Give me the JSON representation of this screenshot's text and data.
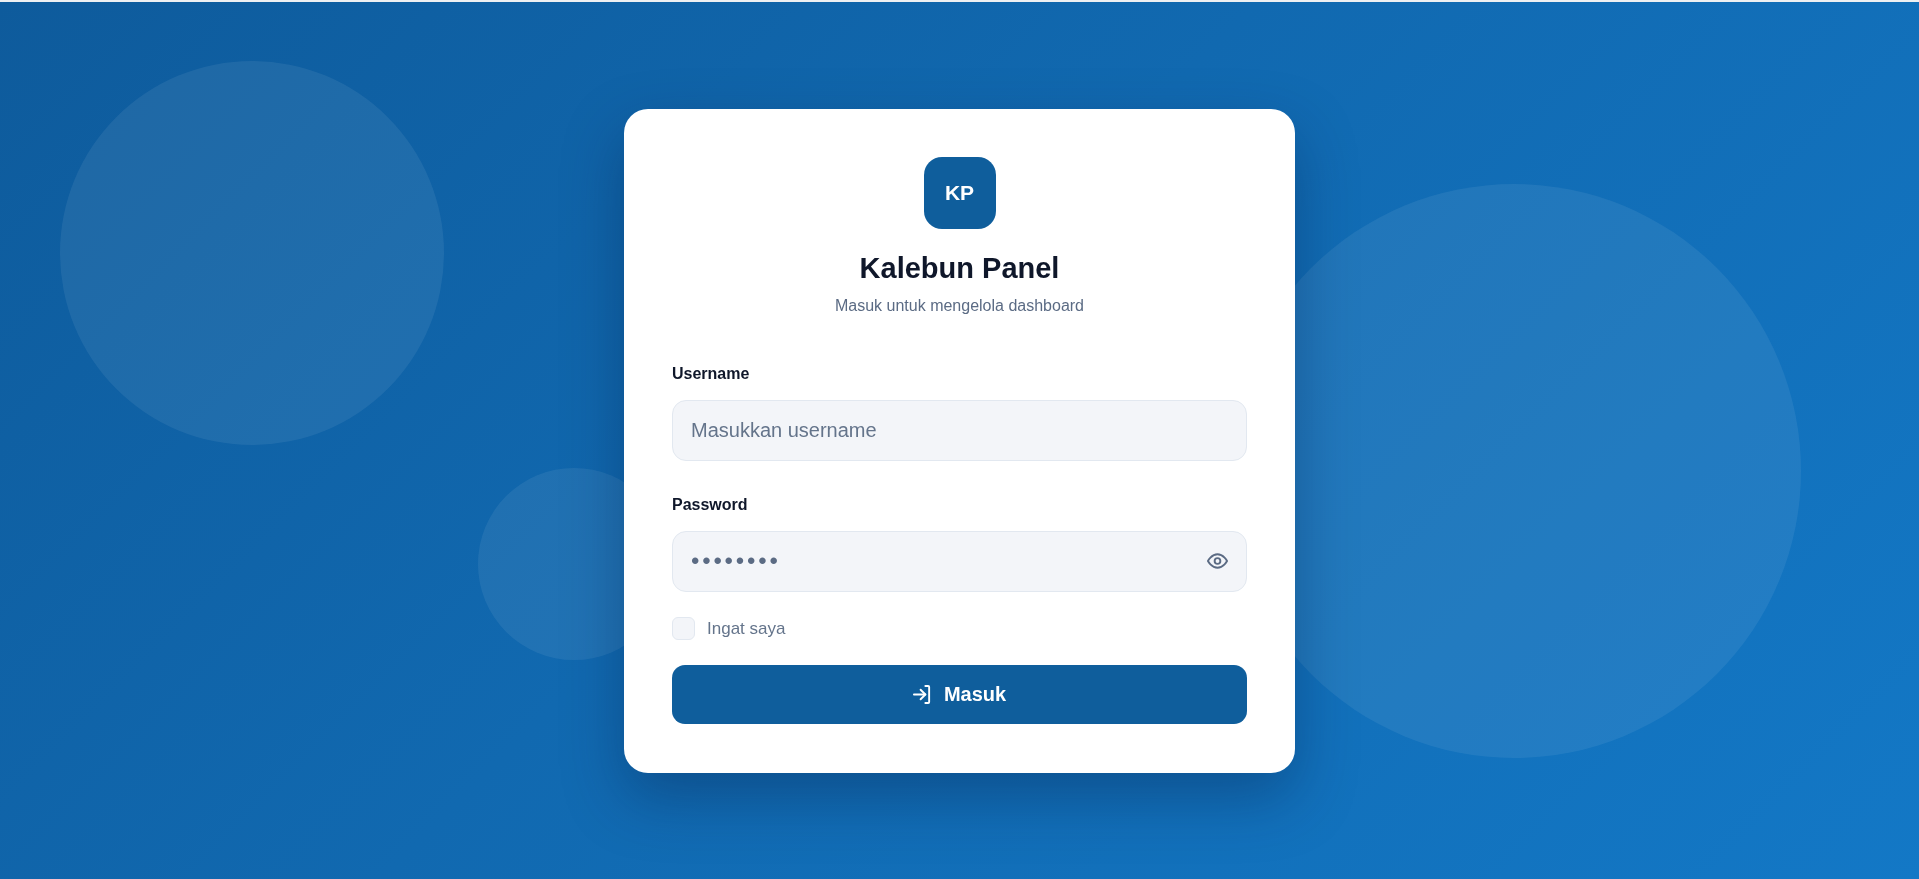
{
  "logo": {
    "text": "KP"
  },
  "title": "Kalebun Panel",
  "subtitle": "Masuk untuk mengelola dashboard",
  "fields": [
    {
      "kind": "text",
      "label": "Username",
      "placeholder": "Masukkan username"
    },
    {
      "kind": "password",
      "label": "Password",
      "value": "••••••••"
    }
  ],
  "remember": {
    "label": "Ingat saya",
    "checked": false
  },
  "submit": {
    "label": "Masuk"
  }
}
